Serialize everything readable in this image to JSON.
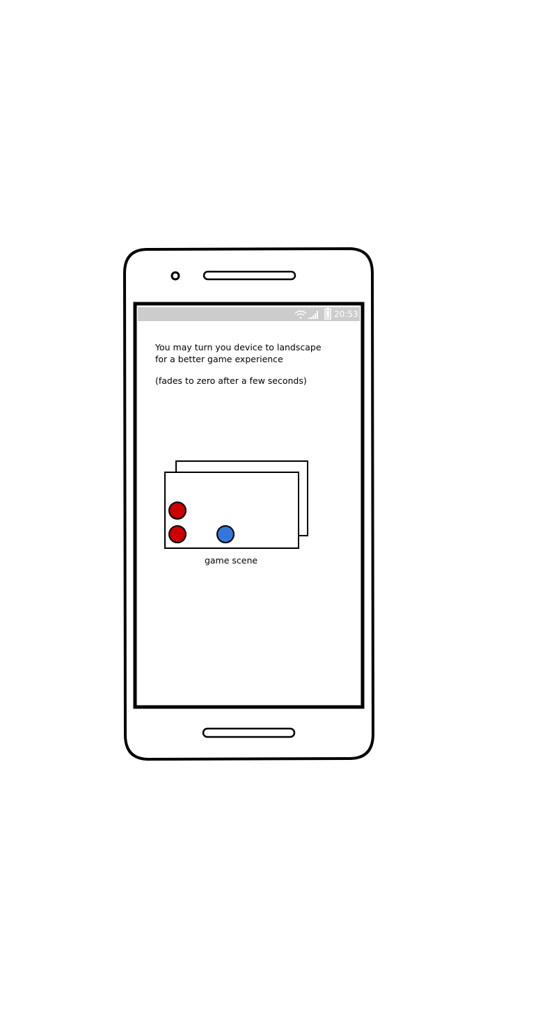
{
  "status_bar": {
    "time": "20:53",
    "icons": [
      "wifi-icon",
      "signal-icon",
      "battery-icon"
    ],
    "background_color": "#cccccc"
  },
  "message": {
    "line1": "You may turn you device to landscape",
    "line2": "for a better game experience",
    "note": "(fades to zero after a few seconds)"
  },
  "game_scene": {
    "label": "game scene",
    "tokens": [
      {
        "name": "red-token-1",
        "color": "#cc0000"
      },
      {
        "name": "red-token-2",
        "color": "#cc0000"
      },
      {
        "name": "blue-token",
        "color": "#3377dd"
      }
    ]
  }
}
